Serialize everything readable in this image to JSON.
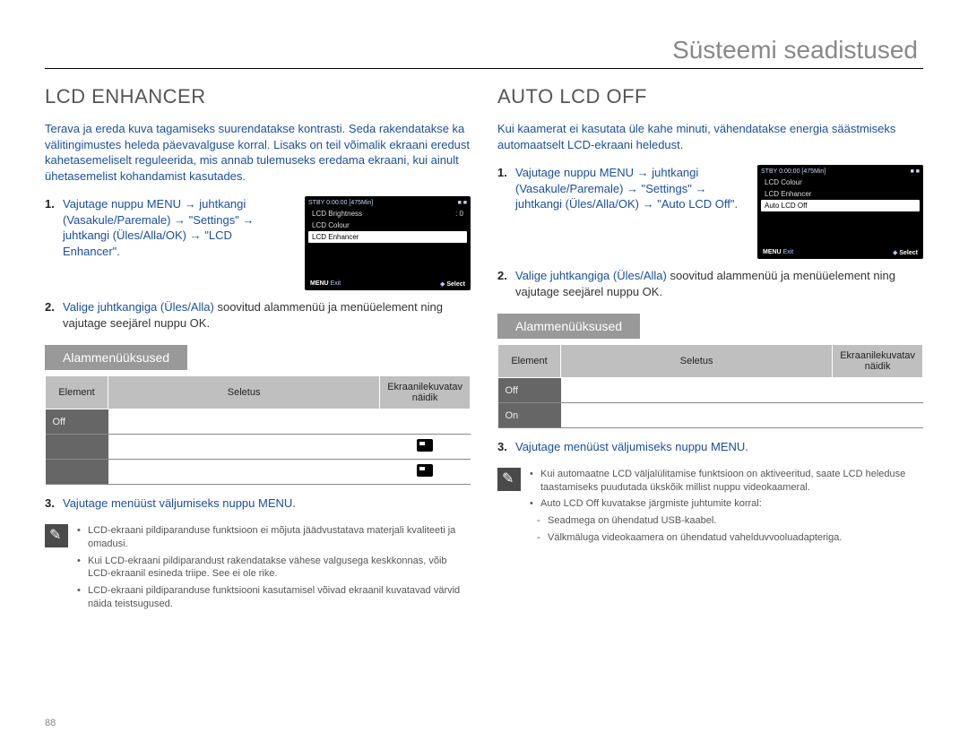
{
  "header": {
    "title": "Süsteemi seadistused"
  },
  "page_number": "88",
  "left": {
    "title": "LCD ENHANCER",
    "intro": "Terava ja ereda kuva tagamiseks suurendatakse kontrasti. Seda rakendatakse ka välitingimustes heleda päevavalguse korral. Lisaks on teil võimalik ekraani eredust kahetasemeliselt reguleerida, mis annab tulemuseks eredama ekraani, kui ainult ühetasemelist kohandamist kasutades.",
    "steps": [
      {
        "blue": "Vajutage nuppu MENU → juhtkangi (Vasakule/Paremale) → \"Settings\" → juhtkangi (Üles/Alla/OK) → \"LCD Enhancer\"."
      },
      {
        "blue": "Valige juhtkangiga (Üles/Alla)",
        "black": " soovitud alammenüü ja menüüelement ning vajutage seejärel nuppu OK."
      },
      {
        "blue": "Vajutage menüüst väljumiseks nuppu MENU."
      }
    ],
    "screenshot": {
      "stby": "STBY 0:00:00 [475Min]",
      "rows": [
        "LCD Brightness",
        "LCD Colour",
        "LCD Enhancer"
      ],
      "values_0": ": 0",
      "exit": "MENU Exit",
      "select": "Select"
    },
    "sub_heading": "Alammenüüksused",
    "table": {
      "headers": [
        "Element",
        "Seletus",
        "Ekraanilekuvatav näidik"
      ],
      "rows": [
        {
          "el": "Off",
          "icon": false
        },
        {
          "el": " ",
          "icon": true
        },
        {
          "el": " ",
          "icon": true
        }
      ]
    },
    "notes": [
      "LCD-ekraani pildiparanduse funktsioon ei mõjuta jäädvustatava materjali kvaliteeti ja omadusi.",
      "Kui LCD-ekraani pildiparandust rakendatakse vähese valgusega keskkonnas, võib LCD-ekraanil esineda triipe. See ei ole rike.",
      "LCD-ekraani pildiparanduse funktsiooni kasutamisel võivad ekraanil kuvatavad värvid näida teistsugused."
    ]
  },
  "right": {
    "title": "AUTO LCD OFF",
    "intro": "Kui kaamerat ei kasutata üle kahe minuti, vähendatakse energia säästmiseks automaatselt LCD-ekraani heledust.",
    "steps": [
      {
        "blue": "Vajutage nuppu MENU → juhtkangi (Vasakule/Paremale) → \"Settings\" → juhtkangi (Üles/Alla/OK) → \"Auto LCD Off\"."
      },
      {
        "blue": "Valige juhtkangiga (Üles/Alla)",
        "black": " soovitud alammenüü ja menüüelement ning vajutage seejärel nuppu OK."
      },
      {
        "blue": "Vajutage menüüst väljumiseks nuppu MENU."
      }
    ],
    "screenshot": {
      "stby": "STBY 0:00:00 [475Min]",
      "rows": [
        "LCD Colour",
        "LCD Enhancer",
        "Auto LCD Off"
      ],
      "exit": "MENU Exit",
      "select": "Select"
    },
    "sub_heading": "Alammenüüksused",
    "table": {
      "headers": [
        "Element",
        "Seletus",
        "Ekraanilekuvatav näidik"
      ],
      "rows": [
        {
          "el": "Off"
        },
        {
          "el": "On"
        }
      ]
    },
    "notes": [
      "Kui automaatne LCD väljalülitamise funktsioon on aktiveeritud, saate LCD heleduse taastamiseks puudutada ükskõik millist nuppu videokaameral.",
      "Auto LCD Off kuvatakse järgmiste juhtumite korral:"
    ],
    "subnotes": [
      "Seadmega on ühendatud USB-kaabel.",
      "Välkmäluga videokaamera on ühendatud vahelduvvooluadapteriga."
    ]
  }
}
